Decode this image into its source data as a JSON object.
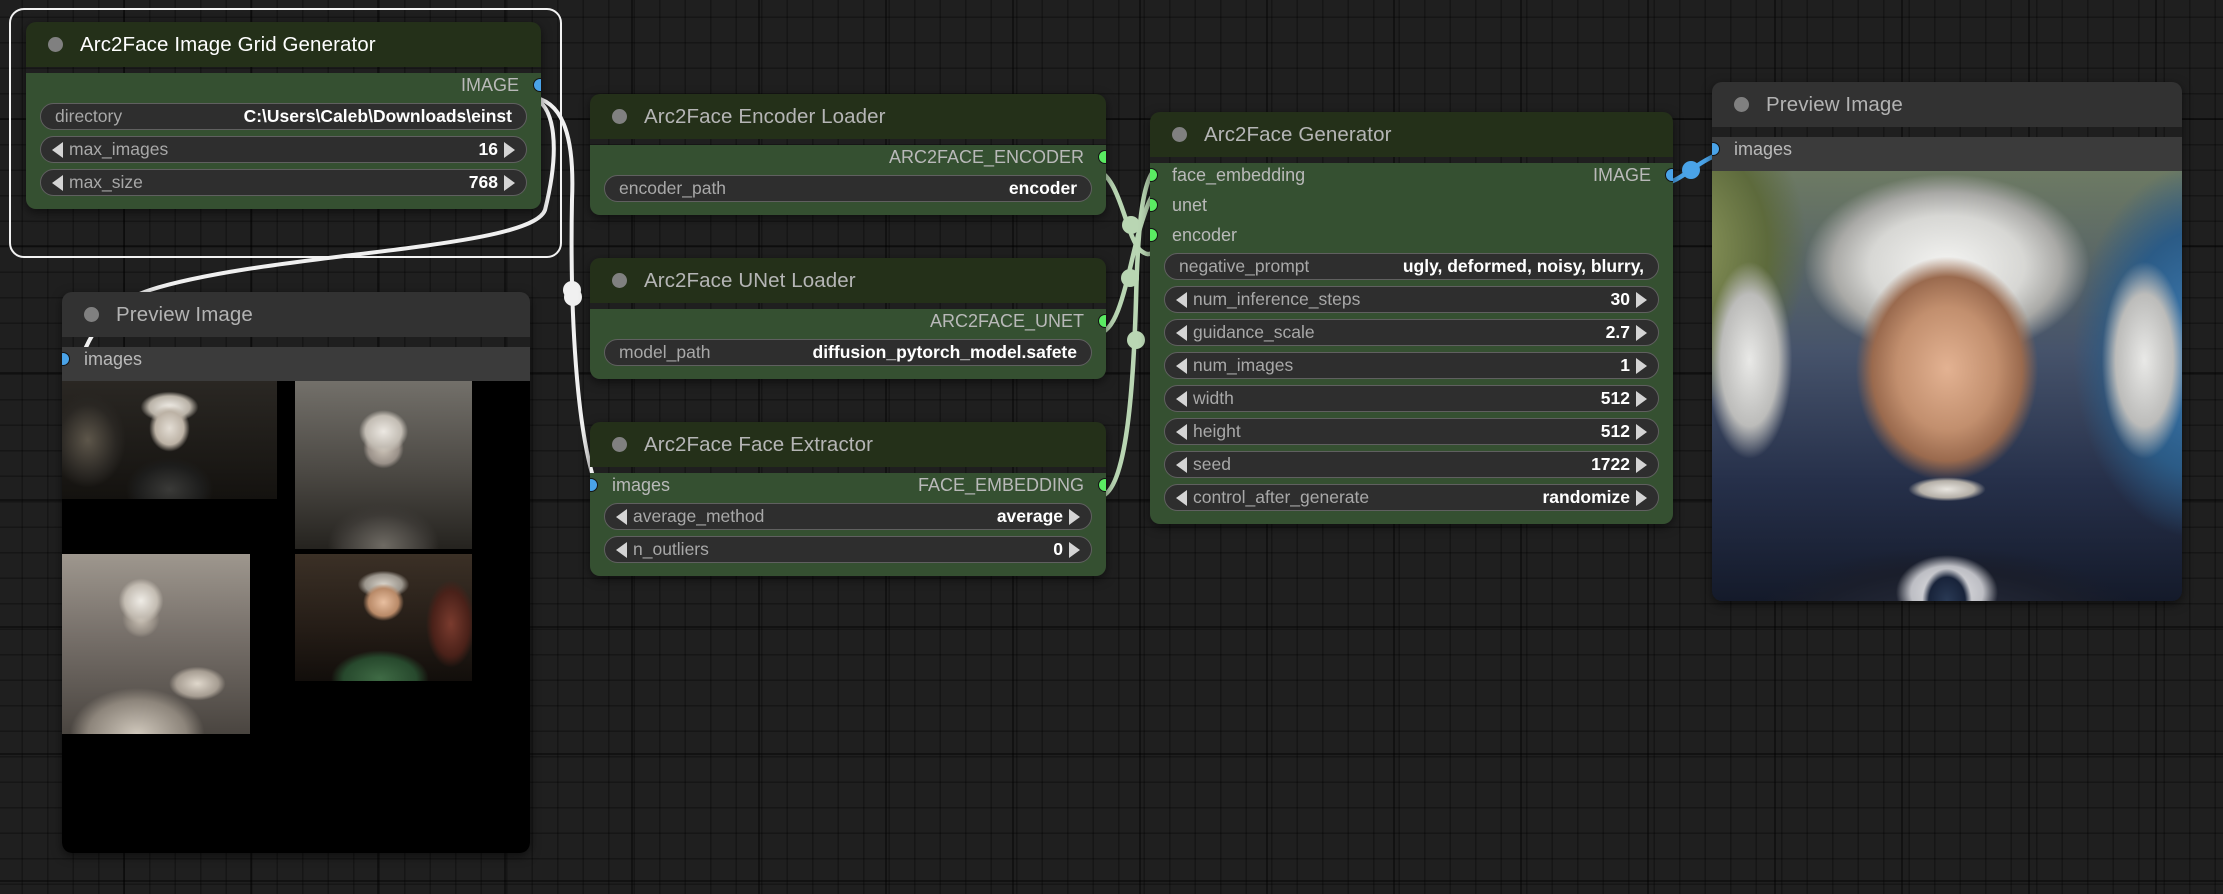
{
  "app": {
    "canvas_background": "#1f1f1f"
  },
  "colors": {
    "node_green_body": "#355031",
    "node_green_header": "#243019",
    "node_grey_body": "#3b3b3b",
    "node_grey_header": "#323232",
    "slot_image_blue": "#4aa3e8",
    "slot_custom_green": "#5aeb62",
    "widget_bg": "#2e2e2e",
    "selection_outline": "#f2f2f2"
  },
  "nodes": {
    "grid_generator": {
      "title": "Arc2Face Image Grid Generator",
      "selected": true,
      "outputs": [
        {
          "label": "IMAGE",
          "color": "#4aa3e8"
        }
      ],
      "widgets": [
        {
          "type": "text",
          "name": "directory",
          "value": "C:\\Users\\Caleb\\Downloads\\einst"
        },
        {
          "type": "combo",
          "name": "max_images",
          "value": "16"
        },
        {
          "type": "combo",
          "name": "max_size",
          "value": "768"
        }
      ]
    },
    "encoder_loader": {
      "title": "Arc2Face Encoder Loader",
      "outputs": [
        {
          "label": "ARC2FACE_ENCODER",
          "color": "#5aeb62"
        }
      ],
      "widgets": [
        {
          "type": "text",
          "name": "encoder_path",
          "value": "encoder"
        }
      ]
    },
    "unet_loader": {
      "title": "Arc2Face UNet Loader",
      "outputs": [
        {
          "label": "ARC2FACE_UNET",
          "color": "#5aeb62"
        }
      ],
      "widgets": [
        {
          "type": "text",
          "name": "model_path",
          "value": "diffusion_pytorch_model.safete"
        }
      ]
    },
    "face_extractor": {
      "title": "Arc2Face Face Extractor",
      "inputs": [
        {
          "label": "images",
          "color": "#4aa3e8"
        }
      ],
      "outputs": [
        {
          "label": "FACE_EMBEDDING",
          "color": "#5aeb62"
        }
      ],
      "widgets": [
        {
          "type": "combo",
          "name": "average_method",
          "value": "average"
        },
        {
          "type": "combo",
          "name": "n_outliers",
          "value": "0"
        }
      ]
    },
    "generator": {
      "title": "Arc2Face Generator",
      "inputs": [
        {
          "label": "face_embedding",
          "color": "#5aeb62"
        },
        {
          "label": "unet",
          "color": "#5aeb62"
        },
        {
          "label": "encoder",
          "color": "#5aeb62"
        }
      ],
      "outputs": [
        {
          "label": "IMAGE",
          "color": "#4aa3e8"
        }
      ],
      "widgets": [
        {
          "type": "text",
          "name": "negative_prompt",
          "value": "ugly, deformed, noisy, blurry,"
        },
        {
          "type": "combo",
          "name": "num_inference_steps",
          "value": "30"
        },
        {
          "type": "combo",
          "name": "guidance_scale",
          "value": "2.7"
        },
        {
          "type": "combo",
          "name": "num_images",
          "value": "1"
        },
        {
          "type": "combo",
          "name": "width",
          "value": "512"
        },
        {
          "type": "combo",
          "name": "height",
          "value": "512"
        },
        {
          "type": "combo",
          "name": "seed",
          "value": "1722"
        },
        {
          "type": "combo",
          "name": "control_after_generate",
          "value": "randomize"
        }
      ]
    },
    "preview_left": {
      "title": "Preview Image",
      "inputs": [
        {
          "label": "images",
          "color": "#4aa3e8"
        }
      ],
      "image_caption": "grid of 4 black-and-white Albert Einstein reference photographs"
    },
    "preview_right": {
      "title": "Preview Image",
      "inputs": [
        {
          "label": "images",
          "color": "#4aa3e8"
        }
      ],
      "image_caption": "generated color portrait of Albert Einstein"
    }
  }
}
